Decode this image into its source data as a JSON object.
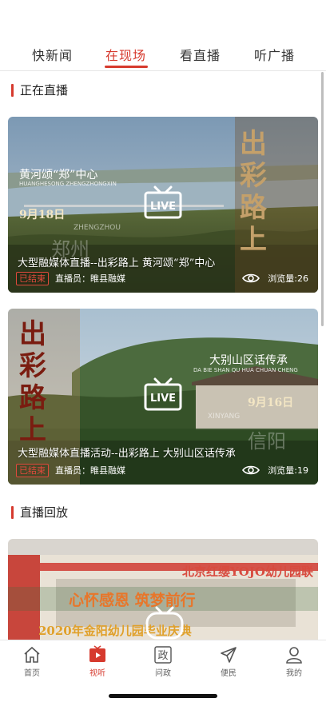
{
  "top_tabs": [
    {
      "label": "快新闻"
    },
    {
      "label": "在现场"
    },
    {
      "label": "看直播"
    },
    {
      "label": "听广播"
    }
  ],
  "sections": {
    "live": "正在直播",
    "replay": "直播回放"
  },
  "cards": [
    {
      "title": "大型融媒体直播--出彩路上 黄河颂“郑”中心",
      "status": "已结束",
      "host": "直播员：睢县融媒",
      "views": "浏览量:26",
      "image_text_main": "黄河颂“郑”中心",
      "image_text_pinyin": "HUANGHESONG ZHENGZHONGXIN",
      "image_date": "9月18日",
      "image_city": "郑州",
      "image_city_pinyin": "ZHENGZHOU",
      "brand": "出彩路上"
    },
    {
      "title": "大型融媒体直播活动--出彩路上 大别山区话传承",
      "status": "已结束",
      "host": "直播员：睢县融媒",
      "views": "浏览量:19",
      "image_text_main": "大别山区话传承",
      "image_text_pinyin": "DA BIE SHAN QU HUA CHUAN CHENG",
      "image_date": "9月16日",
      "image_city": "信阳",
      "image_city_pinyin": "XINYANG",
      "brand": "出彩路上"
    },
    {
      "banner_top": "北京红缨YOJO幼儿园联",
      "banner_middle": "心怀感恩 筑梦前行",
      "banner_bottom": "2020年金阳幼儿园毕业庆典"
    }
  ],
  "bottom_tabs": [
    {
      "label": "首页",
      "icon": "home-icon"
    },
    {
      "label": "视听",
      "icon": "play-icon"
    },
    {
      "label": "问政",
      "icon": "zheng-icon",
      "glyph": "政"
    },
    {
      "label": "便民",
      "icon": "send-icon"
    },
    {
      "label": "我的",
      "icon": "user-icon"
    }
  ],
  "colors": {
    "accent": "#d63a2e"
  }
}
